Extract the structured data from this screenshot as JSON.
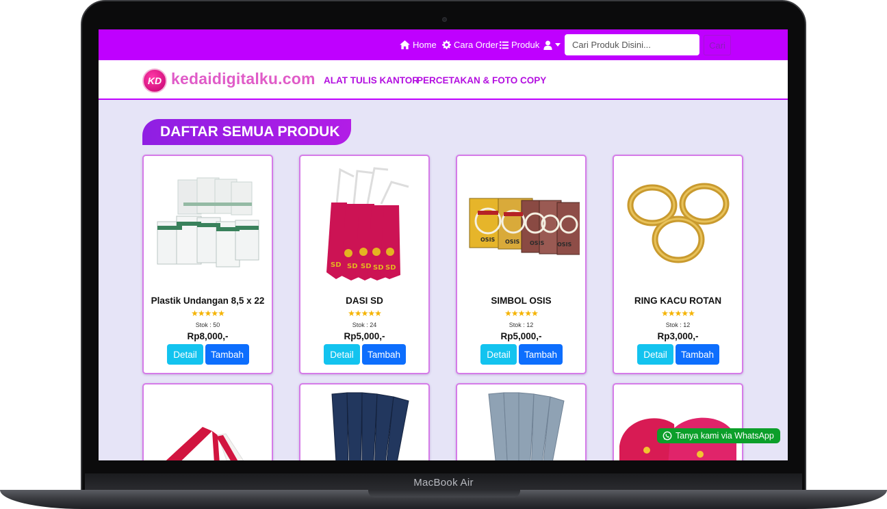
{
  "device": {
    "brand_label": "MacBook Air"
  },
  "topbar": {
    "color": "#bf00ff",
    "nav": [
      {
        "label": "Home",
        "icon": "home-icon"
      },
      {
        "label": "Cara Order",
        "icon": "gear-icon"
      },
      {
        "label": "Produk",
        "icon": "list-icon"
      }
    ],
    "user_icon": "user-icon",
    "search": {
      "placeholder": "Cari Produk Disini...",
      "value": "",
      "button_label": "Cari"
    }
  },
  "brandbar": {
    "logo_initials": "KD",
    "site_name": "kedaidigitalku.com",
    "categories": [
      "ALAT TULIS KANTOR",
      "PERCETAKAN & FOTO COPY"
    ]
  },
  "section": {
    "title": "DAFTAR SEMUA PRODUK"
  },
  "products": [
    {
      "name": "Plastik Undangan 8,5 x 22",
      "rating": "★★★★★",
      "stock": "Stok : 50",
      "price": "Rp8,000,-",
      "detail_label": "Detail",
      "add_label": "Tambah",
      "image": "plastic-sleeves-image"
    },
    {
      "name": "DASI SD",
      "rating": "★★★★★",
      "stock": "Stok : 24",
      "price": "Rp5,000,-",
      "detail_label": "Detail",
      "add_label": "Tambah",
      "image": "red-school-ties-image"
    },
    {
      "name": "SIMBOL OSIS",
      "rating": "★★★★★",
      "stock": "Stok : 12",
      "price": "Rp5,000,-",
      "detail_label": "Detail",
      "add_label": "Tambah",
      "image": "osis-badges-image"
    },
    {
      "name": "RING KACU ROTAN",
      "rating": "★★★★★",
      "stock": "Stok : 12",
      "price": "Rp3,000,-",
      "detail_label": "Detail",
      "add_label": "Tambah",
      "image": "rattan-rings-image"
    }
  ],
  "products_row2": [
    {
      "image": "red-white-flag-image"
    },
    {
      "image": "navy-ties-image"
    },
    {
      "image": "grey-ties-image"
    },
    {
      "image": "red-caps-image"
    }
  ],
  "whatsapp": {
    "label": "Tanya kami via WhatsApp",
    "color": "#0c9f2a"
  }
}
